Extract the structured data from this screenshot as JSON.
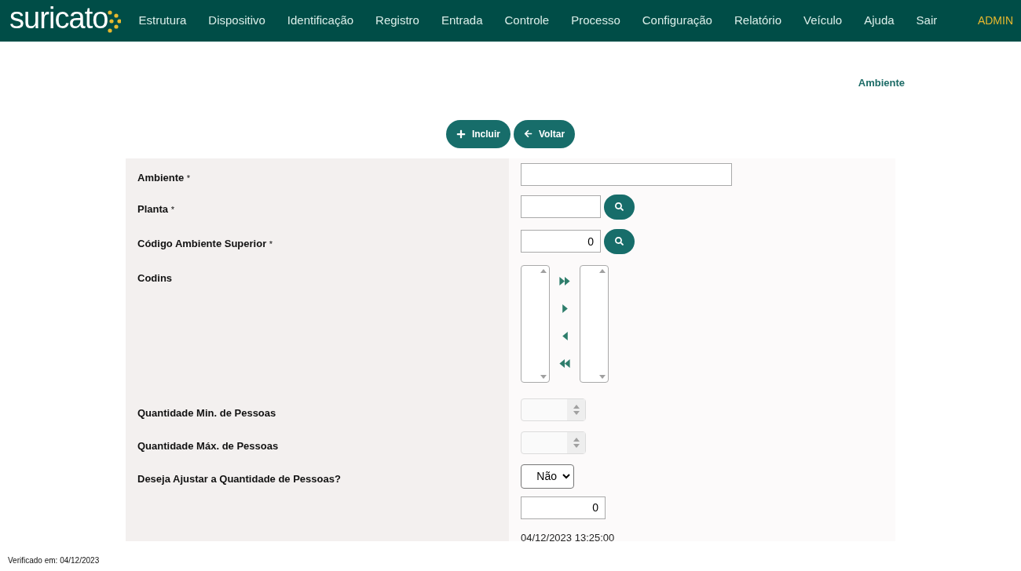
{
  "header": {
    "logo": "suricato",
    "nav": [
      "Estrutura",
      "Dispositivo",
      "Identificação",
      "Registro",
      "Entrada",
      "Controle",
      "Processo",
      "Configuração",
      "Relatório",
      "Veículo",
      "Ajuda",
      "Sair"
    ],
    "user": "ADMIN"
  },
  "page_title": "Ambiente",
  "actions": [
    {
      "kind": "add",
      "label": "Incluir"
    },
    {
      "kind": "back",
      "label": "Voltar"
    }
  ],
  "form": [
    {
      "kind": "text",
      "label": "Ambiente",
      "required_mark": "*"
    },
    {
      "kind": "lookup",
      "label": "Planta",
      "required_mark": "*"
    },
    {
      "kind": "lookup",
      "label": "Código Ambiente Superior",
      "required_mark": "*",
      "value": "0"
    },
    {
      "kind": "dual_list",
      "label": "Codins"
    },
    {
      "kind": "spinner",
      "label": "Quantidade Min. de Pessoas",
      "disabled": true
    },
    {
      "kind": "spinner",
      "label": "Quantidade Máx. de Pessoas",
      "disabled": true
    },
    {
      "kind": "select",
      "label": "Deseja Ajustar a Quantidade de Pessoas?",
      "value": "Não"
    },
    {
      "kind": "number",
      "value": "0"
    },
    {
      "kind": "static",
      "value": "04/12/2023 13:25:00"
    }
  ],
  "footer": "Verificado em: 04/12/2023"
}
